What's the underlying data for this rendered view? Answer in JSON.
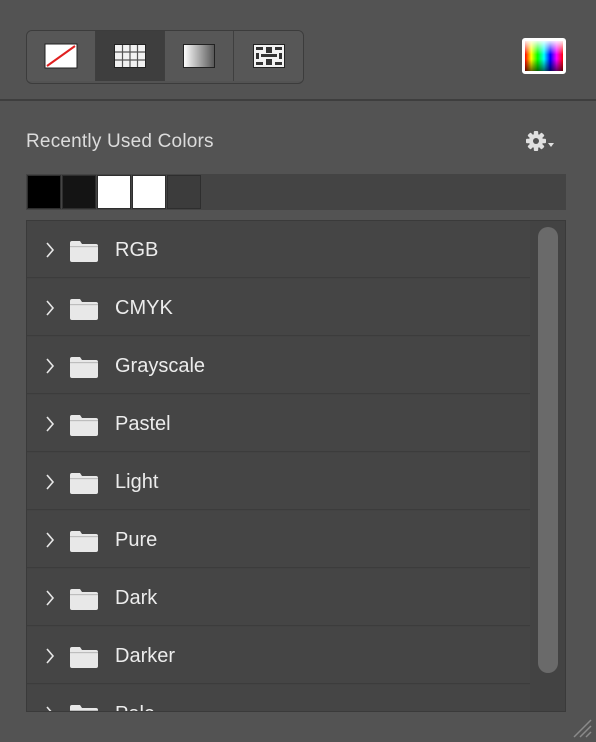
{
  "toolbar": {
    "buttons": [
      {
        "name": "none-fill-button",
        "icon": "no-color-icon"
      },
      {
        "name": "swatches-button",
        "icon": "grid-icon",
        "active": true
      },
      {
        "name": "gradient-button",
        "icon": "gradient-icon"
      },
      {
        "name": "pattern-button",
        "icon": "pattern-icon"
      }
    ],
    "picker_icon": "color-spectrum-icon"
  },
  "recent": {
    "title": "Recently Used Colors",
    "gear_icon": "gear-icon",
    "colors": [
      "#000000",
      "#141414",
      "#ffffff",
      "#ffffff",
      "#3c3c3c"
    ]
  },
  "groups": [
    {
      "label": "RGB"
    },
    {
      "label": "CMYK"
    },
    {
      "label": "Grayscale"
    },
    {
      "label": "Pastel"
    },
    {
      "label": "Light"
    },
    {
      "label": "Pure"
    },
    {
      "label": "Dark"
    },
    {
      "label": "Darker"
    },
    {
      "label": "Pale"
    }
  ]
}
